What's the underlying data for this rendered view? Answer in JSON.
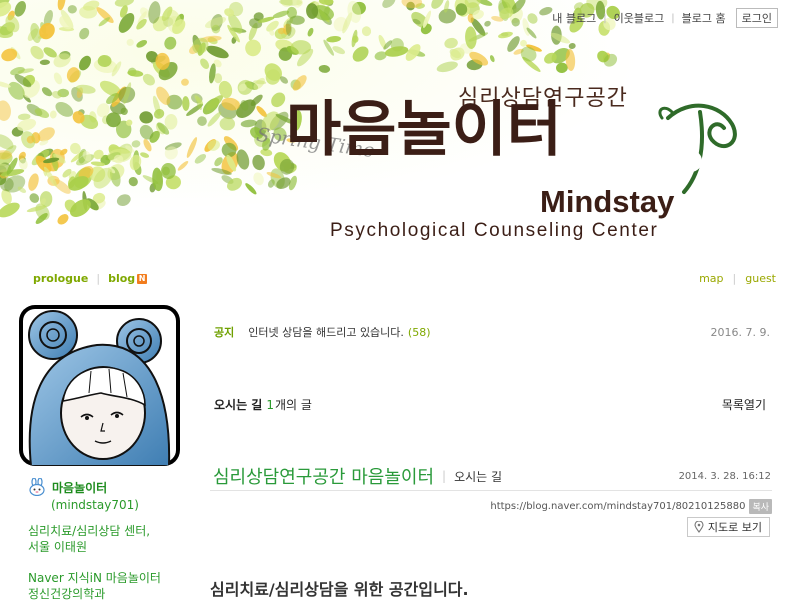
{
  "topnav": {
    "my_blog": "내 블로그",
    "neighbor_blog": "이웃블로그",
    "blog_home": "블로그 홈",
    "login": "로그인"
  },
  "banner": {
    "korean_subtitle": "심리상담연구공간",
    "logo_korean": "마음놀이터",
    "logo_english": "Mindstay",
    "tagline": "Psychological Counseling Center",
    "script_text": "Spring Time",
    "colors": {
      "logo": "#3b1e16",
      "swirl": "#2f6b2a"
    }
  },
  "subnav": {
    "prologue": "prologue",
    "blog": "blog",
    "blog_badge": "N",
    "map": "map",
    "guest": "guest"
  },
  "profile": {
    "nickname": "마음놀이터",
    "user_id": "(mindstay701)",
    "desc_line1": "심리치료/심리상담 센터,",
    "desc_line2": "서울 이태원",
    "desc_line3": "Naver 지식iN 마음놀이터",
    "desc_line4": "정신건강의학과"
  },
  "notice": {
    "label": "공지",
    "title": "인터넷 상담을 해드리고 있습니다.",
    "comment_count": "(58)",
    "date": "2016. 7. 9."
  },
  "category": {
    "name": "오시는 길",
    "count": "1",
    "unit": "개의 글",
    "toggle": "목록열기"
  },
  "post": {
    "title": "심리상담연구공간 마음놀이터",
    "category": "오시는 길",
    "datetime": "2014. 3. 28. 16:12",
    "url": "https://blog.naver.com/mindstay701/80210125880",
    "copy_label": "복사",
    "map_button": "지도로 보기",
    "body_heading": "심리치료/심리상담을 위한 공간입니다."
  },
  "colors": {
    "green_link": "#2a9a3a",
    "yellow_green": "#7fa800",
    "badge_orange": "#f27d1e"
  }
}
